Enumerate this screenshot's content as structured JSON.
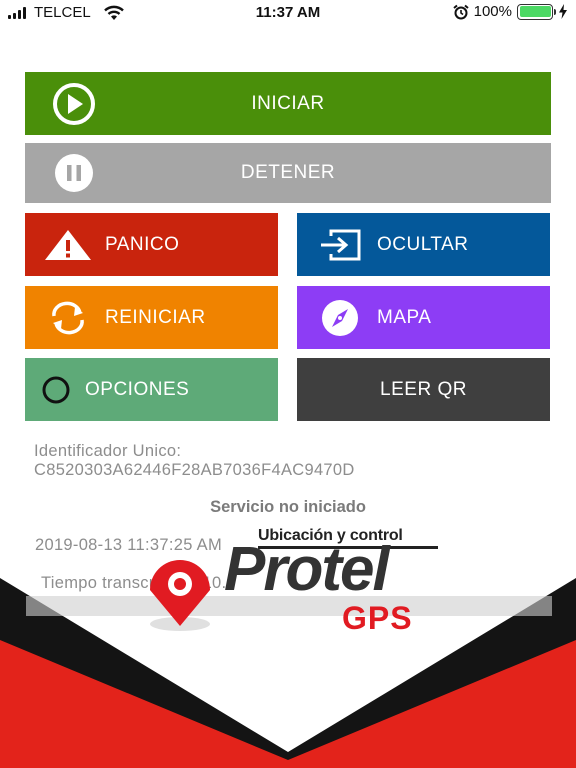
{
  "status_bar": {
    "carrier": "TELCEL",
    "time": "11:37 AM",
    "battery_percent": "100%"
  },
  "buttons": {
    "iniciar": "INICIAR",
    "detener": "DETENER",
    "panico": "PANICO",
    "ocultar": "OCULTAR",
    "reiniciar": "REINICIAR",
    "mapa": "MAPA",
    "opciones": "OPCIONES",
    "leer_qr": "LEER QR"
  },
  "colors": {
    "iniciar": "#4a8f0a",
    "detener": "#a6a6a6",
    "panico": "#c9240d",
    "ocultar": "#04589a",
    "reiniciar": "#f08300",
    "mapa": "#8d3df5",
    "opciones": "#5eaa78",
    "leer_qr": "#3f3f3f",
    "brand_red": "#e11b22"
  },
  "info": {
    "id_label": "Identificador Unico:",
    "id_value": "C8520303A62446F28AB7036F4AC9470D",
    "service_status": "Servicio no iniciado",
    "datetime": "2019-08-13 11:37:25 AM",
    "elapsed": "Tiempo transcurrido: 10.0"
  },
  "logo": {
    "tagline": "Ubicación y control",
    "name": "Protel",
    "product": "GPS"
  },
  "icons": {
    "iniciar": "play-circle-icon",
    "detener": "pause-circle-icon",
    "panico": "warning-icon",
    "ocultar": "exit-icon",
    "reiniciar": "refresh-icon",
    "mapa": "compass-icon",
    "opciones": "circle-icon"
  }
}
